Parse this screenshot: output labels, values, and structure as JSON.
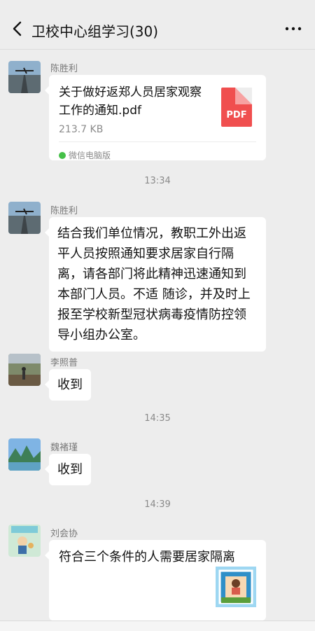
{
  "header": {
    "title": "卫校中心组学习(30)"
  },
  "messages": [
    {
      "sender": "陈胜利",
      "file_name": "关于做好返郑人员居家观察工作的通知.pdf",
      "file_size": "213.7 KB",
      "file_type": "PDF",
      "source": "微信电脑版"
    },
    {
      "timestamp": "13:34"
    },
    {
      "sender": "陈胜利",
      "text": "结合我们单位情况，教职工外出返平人员按照通知要求居家自行隔离，请各部门将此精神迅速通知到本部门人员。不适 随诊，并及时上报至学校新型冠状病毒疫情防控领导小组办公室。"
    },
    {
      "sender": "李照普",
      "text": "收到"
    },
    {
      "timestamp": "14:35"
    },
    {
      "sender": "魏褚瑾",
      "text": "收到"
    },
    {
      "timestamp": "14:39"
    },
    {
      "sender": "刘会协",
      "text": "符合三个条件的人需要居家隔离"
    }
  ],
  "colors": {
    "background": "#ededed",
    "bubble": "#ffffff",
    "pdf": "#f04f4f",
    "wechat_green": "#45c048"
  }
}
